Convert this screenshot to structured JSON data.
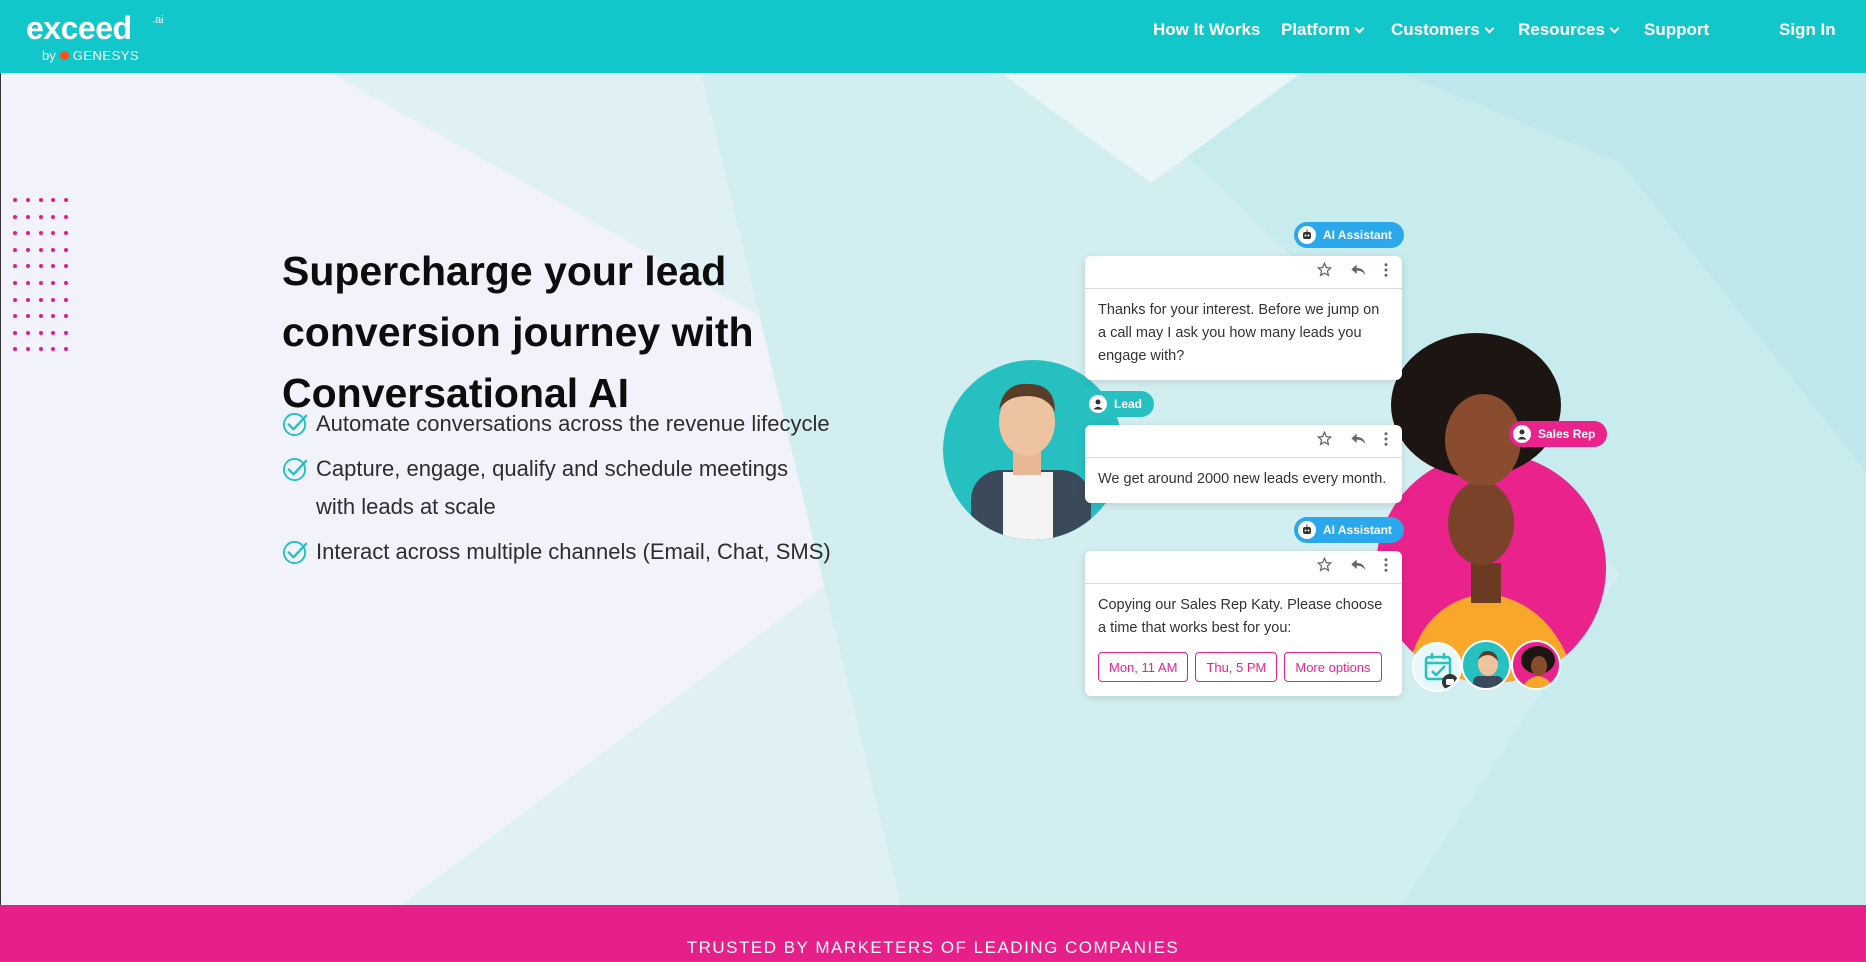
{
  "header": {
    "logo": {
      "main": "exceed",
      "sup": ".ai",
      "by": "by",
      "partner": "GENESYS"
    },
    "nav": [
      {
        "label": "How It Works",
        "dropdown": false
      },
      {
        "label": "Platform",
        "dropdown": true
      },
      {
        "label": "Customers",
        "dropdown": true
      },
      {
        "label": "Resources",
        "dropdown": true
      },
      {
        "label": "Support",
        "dropdown": false
      }
    ],
    "sign_in": "Sign In"
  },
  "hero": {
    "headline": "Supercharge your lead conversion journey with Conversational AI",
    "bullets": [
      "Automate conversations across the revenue lifecycle",
      "Capture, engage, qualify and schedule meetings with leads at scale",
      "Interact across multiple channels (Email, Chat, SMS)"
    ]
  },
  "illustration": {
    "tags": {
      "ai_assistant": "AI Assistant",
      "lead": "Lead",
      "sales_rep": "Sales Rep"
    },
    "messages": [
      {
        "text": "Thanks for your interest. Before we jump on a call may I ask you how many leads you engage with?"
      },
      {
        "text": "We get around 2000 new leads every month."
      },
      {
        "text": "Copying our Sales Rep Katy. Please choose a time that works best for you:"
      }
    ],
    "options": [
      "Mon, 11 AM",
      "Thu, 5 PM",
      "More options"
    ]
  },
  "trust_band": {
    "text": "TRUSTED BY MARKETERS OF LEADING COMPANIES"
  },
  "colors": {
    "teal": "#12c7c9",
    "pink": "#e61f8a",
    "blue": "#2ba8ec"
  }
}
